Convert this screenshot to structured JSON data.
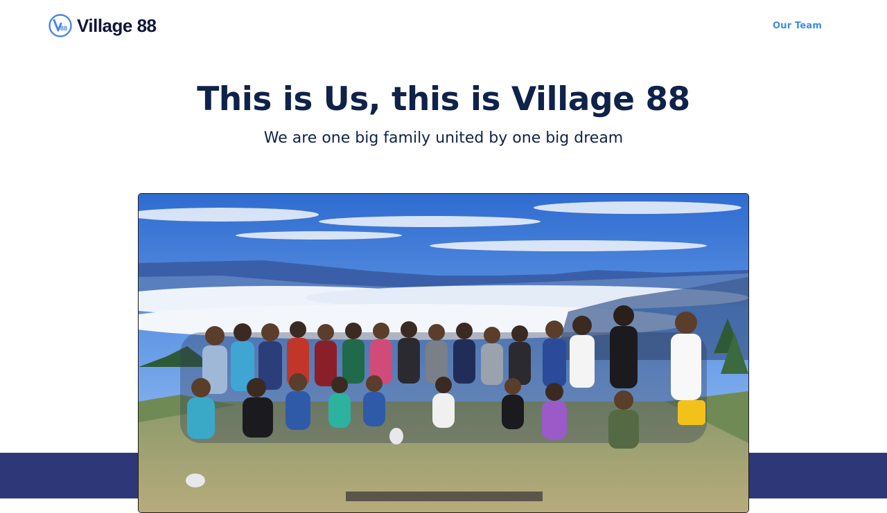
{
  "brand": {
    "name": "Village 88",
    "mark_text": "V88",
    "primary_color": "#101638",
    "accent_color": "#3d8de0"
  },
  "nav": {
    "links": [
      {
        "label": "Our Team"
      }
    ]
  },
  "hero": {
    "title": "This is Us, this is Village 88",
    "subtitle": "We are one big family united by one big dream"
  },
  "colors": {
    "title": "#0f2249",
    "footer_band": "#2e3878"
  }
}
